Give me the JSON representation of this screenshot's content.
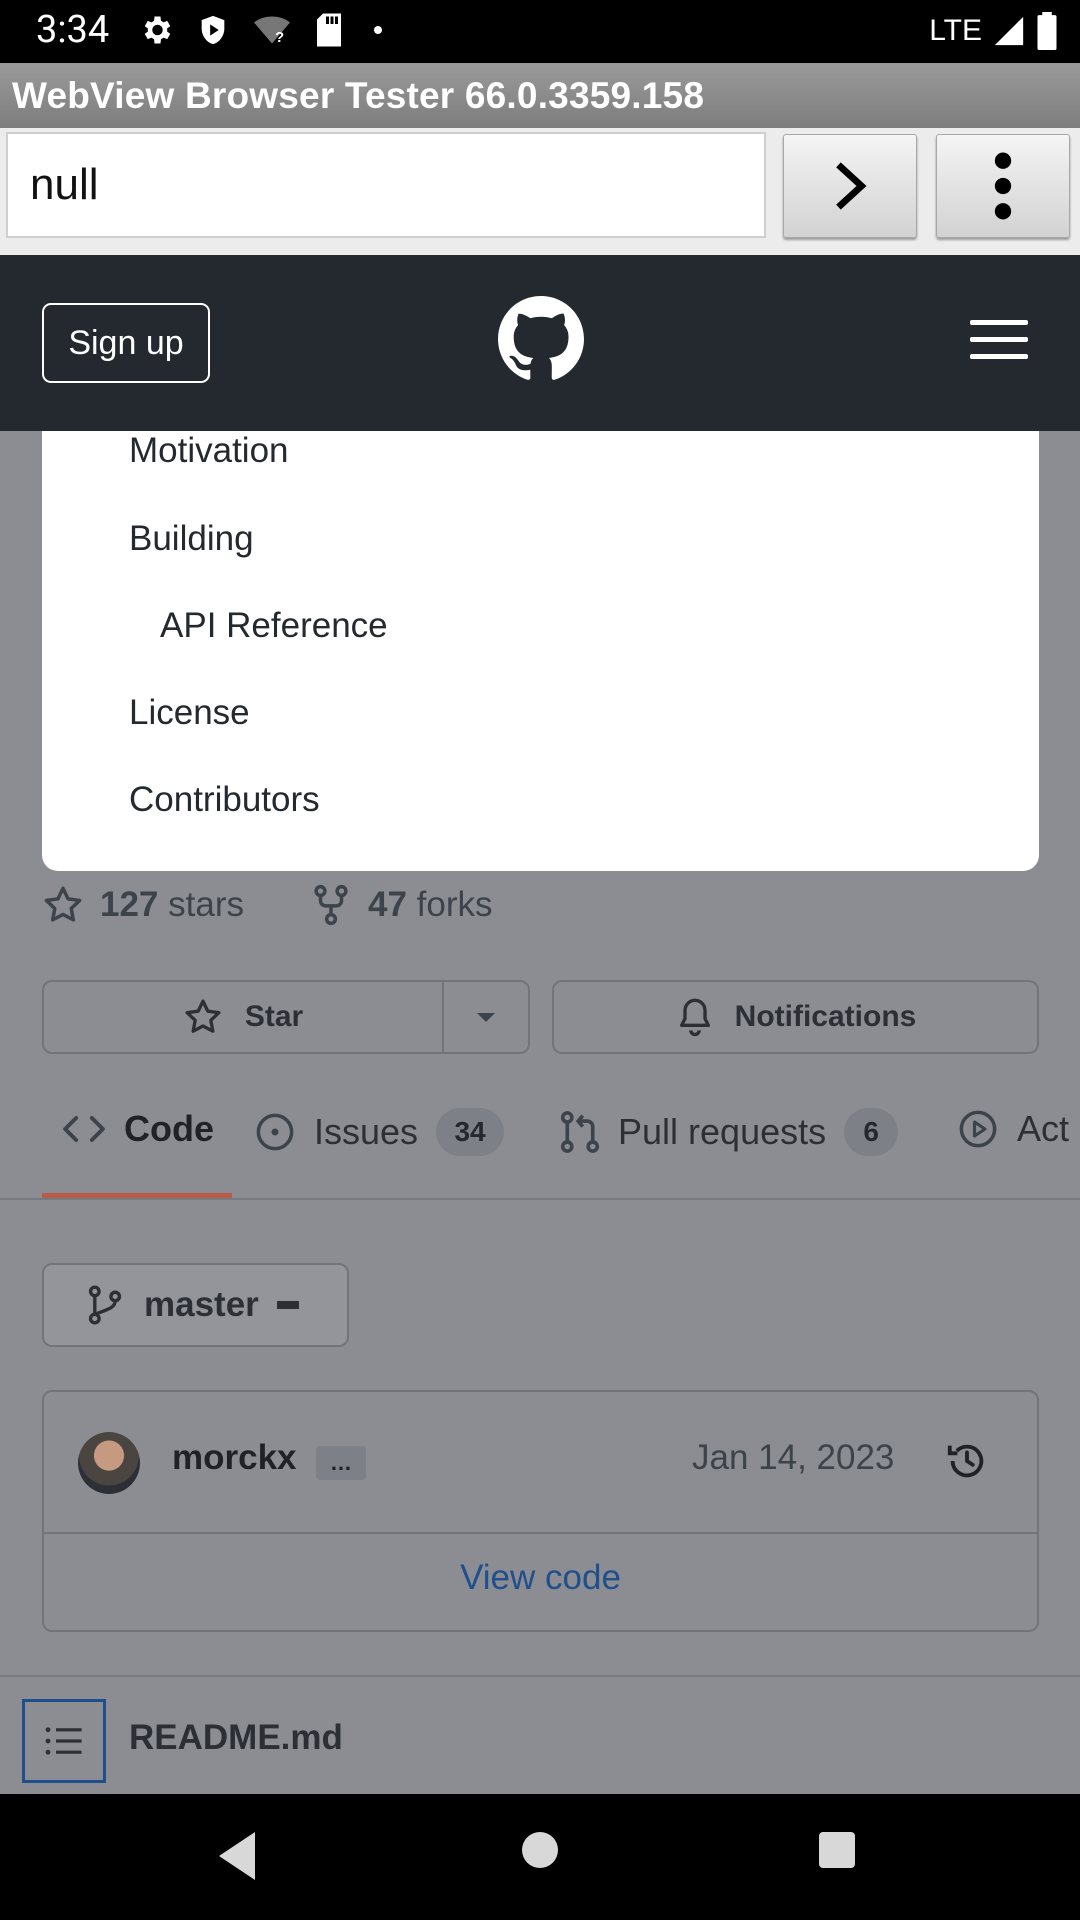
{
  "status_bar": {
    "time": "3:34",
    "network": "LTE",
    "icons": [
      "gear-icon",
      "shield-icon",
      "wifi-question-icon",
      "sd-card-icon",
      "dot-icon",
      "signal-icon",
      "battery-icon"
    ]
  },
  "app": {
    "title": "WebView Browser Tester 66.0.3359.158",
    "url_value": "null"
  },
  "gh_header": {
    "signup_label": "Sign up"
  },
  "toc": {
    "items": [
      "Motivation",
      "Building",
      "API Reference",
      "License",
      "Contributors"
    ]
  },
  "stats": {
    "stars_count": "127",
    "stars_label": "stars",
    "forks_count": "47",
    "forks_label": "forks"
  },
  "actions": {
    "star_label": "Star",
    "notifications_label": "Notifications"
  },
  "tabs": [
    {
      "label": "Code",
      "active": true
    },
    {
      "label": "Issues",
      "count": "34"
    },
    {
      "label": "Pull requests",
      "count": "6"
    },
    {
      "label": "Act"
    }
  ],
  "branch": {
    "name": "master"
  },
  "commit": {
    "author": "morckx",
    "ellipsis": "…",
    "date": "Jan 14, 2023",
    "view_code_label": "View code"
  },
  "readme": {
    "filename": "README.md"
  },
  "colors": {
    "header_bg": "#24292f",
    "tab_underline": "#b75c4a",
    "link": "#1f4f8c"
  }
}
